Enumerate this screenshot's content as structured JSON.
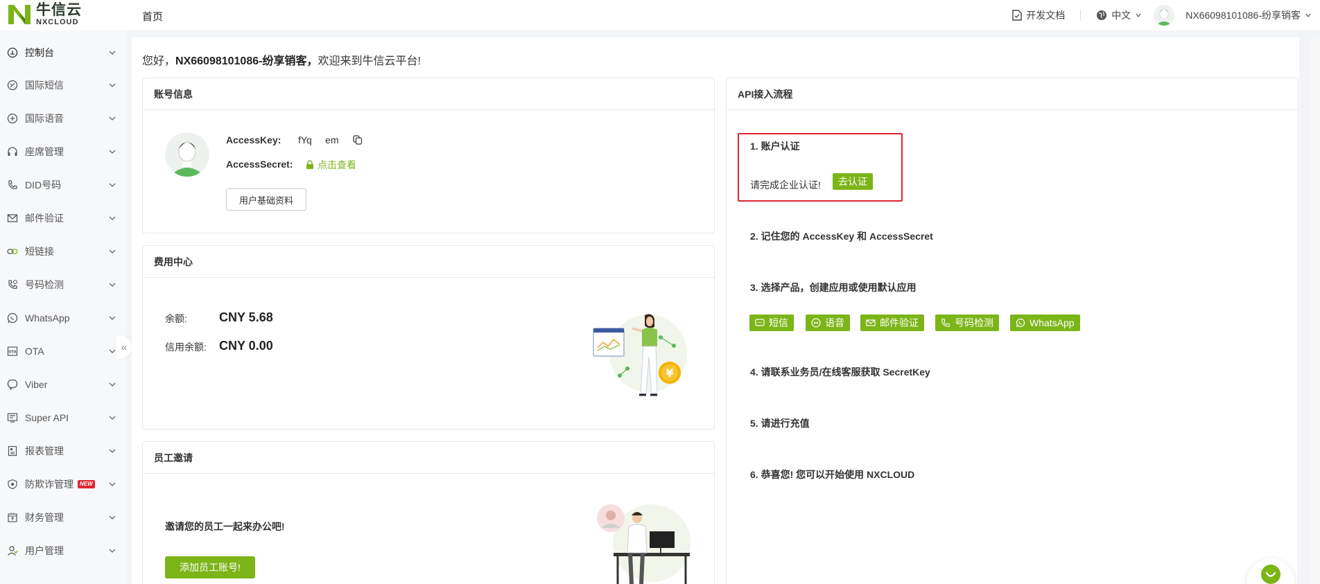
{
  "header": {
    "logo_cn": "牛信云",
    "logo_en": "NXCLOUD",
    "nav_home": "首页",
    "dev_docs": "开发文档",
    "language": "中文",
    "username": "NX66098101086-纷享销客"
  },
  "sidebar": {
    "items": [
      {
        "label": "控制台",
        "icon": "dashboard-icon"
      },
      {
        "label": "国际短信",
        "icon": "sms-icon"
      },
      {
        "label": "国际语音",
        "icon": "voice-icon"
      },
      {
        "label": "座席管理",
        "icon": "headset-icon"
      },
      {
        "label": "DID号码",
        "icon": "phone-icon"
      },
      {
        "label": "邮件验证",
        "icon": "mail-icon"
      },
      {
        "label": "短链接",
        "icon": "link-icon"
      },
      {
        "label": "号码检测",
        "icon": "phone-check-icon"
      },
      {
        "label": "WhatsApp",
        "icon": "whatsapp-icon"
      },
      {
        "label": "OTA",
        "icon": "ota-icon"
      },
      {
        "label": "Viber",
        "icon": "viber-icon"
      },
      {
        "label": "Super API",
        "icon": "api-icon"
      },
      {
        "label": "报表管理",
        "icon": "report-icon"
      },
      {
        "label": "防欺诈管理",
        "icon": "shield-icon",
        "badge": "NEW"
      },
      {
        "label": "财务管理",
        "icon": "finance-icon"
      },
      {
        "label": "用户管理",
        "icon": "user-icon"
      }
    ],
    "collapse_glyph": "«"
  },
  "welcome": {
    "prefix": "您好，",
    "name": "NX66098101086-纷享销客，",
    "suffix": "欢迎来到牛信云平台!"
  },
  "account": {
    "title": "账号信息",
    "access_key_label": "AccessKey:",
    "access_key_value": "fYq     em",
    "access_secret_label": "AccessSecret:",
    "access_secret_link": "点击查看",
    "profile_button": "用户基础资料"
  },
  "billing": {
    "title": "费用中心",
    "balance_label": "余额:",
    "balance_value": "CNY 5.68",
    "credit_label": "信用余额:",
    "credit_value": "CNY 0.00",
    "coin_glyph": "¥"
  },
  "invite": {
    "title": "员工邀请",
    "text": "邀请您的员工一起来办公吧!",
    "button": "添加员工账号!"
  },
  "api_flow": {
    "title": "API接入流程",
    "step1_title": "1. 账户认证",
    "step1_text": "请完成企业认证!",
    "step1_button": "去认证",
    "step2_title": "2. 记住您的 AccessKey 和 AccessSecret",
    "step3_title": "3. 选择产品，创建应用或使用默认应用",
    "products": [
      {
        "label": "短信",
        "icon": "sms-icon"
      },
      {
        "label": "语音",
        "icon": "voice-icon"
      },
      {
        "label": "邮件验证",
        "icon": "mail-icon"
      },
      {
        "label": "号码检测",
        "icon": "phone-check-icon"
      },
      {
        "label": "WhatsApp",
        "icon": "whatsapp-icon"
      }
    ],
    "step4_title": "4. 请联系业务员/在线客服获取 SecretKey",
    "step5_title": "5. 请进行充值",
    "step6_title": "6. 恭喜您! 您可以开始使用 NXCLOUD"
  },
  "colors": {
    "brand_green": "#7cb518",
    "highlight_red": "#e0262f"
  }
}
